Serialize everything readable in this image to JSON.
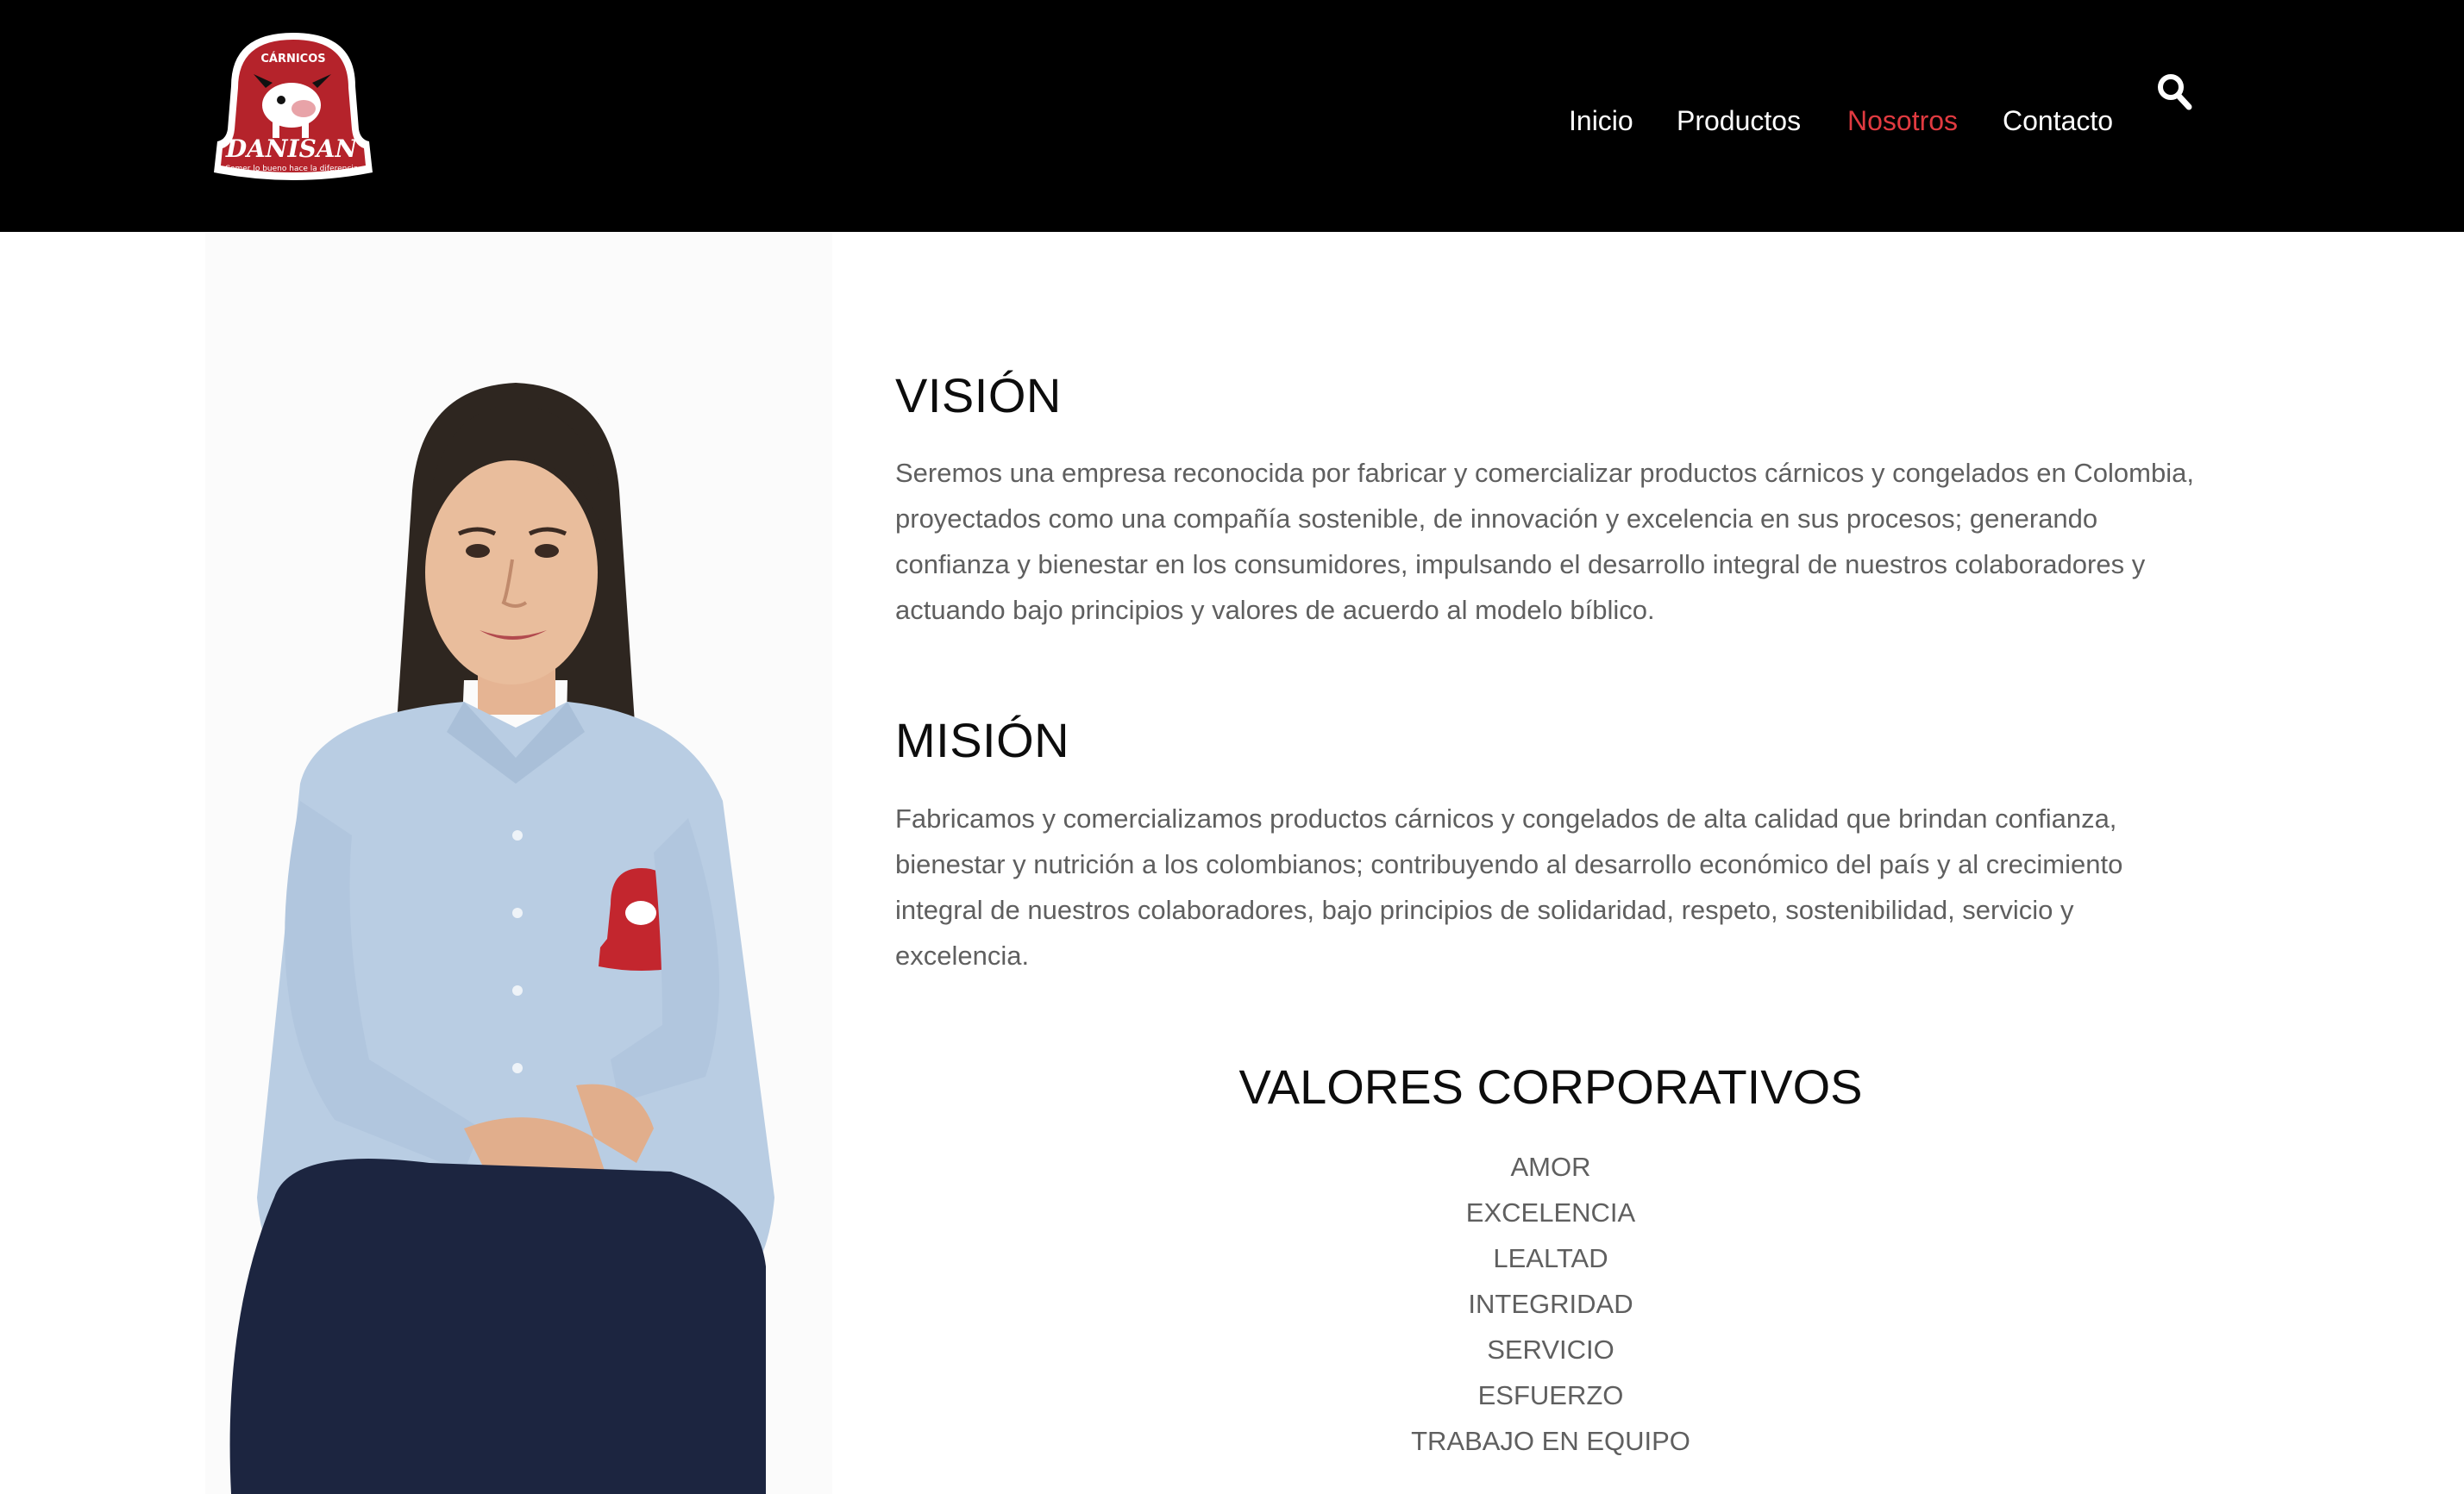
{
  "header": {
    "logo": {
      "brand": "DANISAN",
      "tagline": "CÁRNICOS",
      "slogan": "Comer lo bueno hace la diferencia"
    },
    "nav": [
      "Inicio",
      "Productos",
      "Nosotros",
      "Contacto"
    ],
    "active_nav": "Nosotros",
    "search_icon": "search-icon"
  },
  "colors": {
    "header_bg": "#000000",
    "accent": "#e03a40",
    "logo_red": "#b5232b"
  },
  "vision": {
    "title": "VISIÓN",
    "text": "Seremos una empresa reconocida por fabricar y comercializar productos cárnicos y congelados en Colombia, proyectados como una compañía sostenible, de innovación y excelencia en sus procesos; generando confianza y bienestar en los consumidores, impulsando el desarrollo integral de nuestros colaboradores y actuando bajo principios y valores de acuerdo al modelo bíblico."
  },
  "mision": {
    "title": "MISIÓN",
    "text": "Fabricamos y comercializamos productos cárnicos y congelados de alta calidad que brindan confianza, bienestar y nutrición a los colombianos; contribuyendo al desarrollo económico del país y al crecimiento integral de nuestros colaboradores, bajo principios de solidaridad, respeto, sostenibilidad, servicio y excelencia."
  },
  "valores": {
    "title": "VALORES CORPORATIVOS",
    "items": [
      "AMOR",
      "EXCELENCIA",
      "LEALTAD",
      "INTEGRIDAD",
      "SERVICIO",
      "ESFUERZO",
      "TRABAJO EN EQUIPO"
    ]
  }
}
